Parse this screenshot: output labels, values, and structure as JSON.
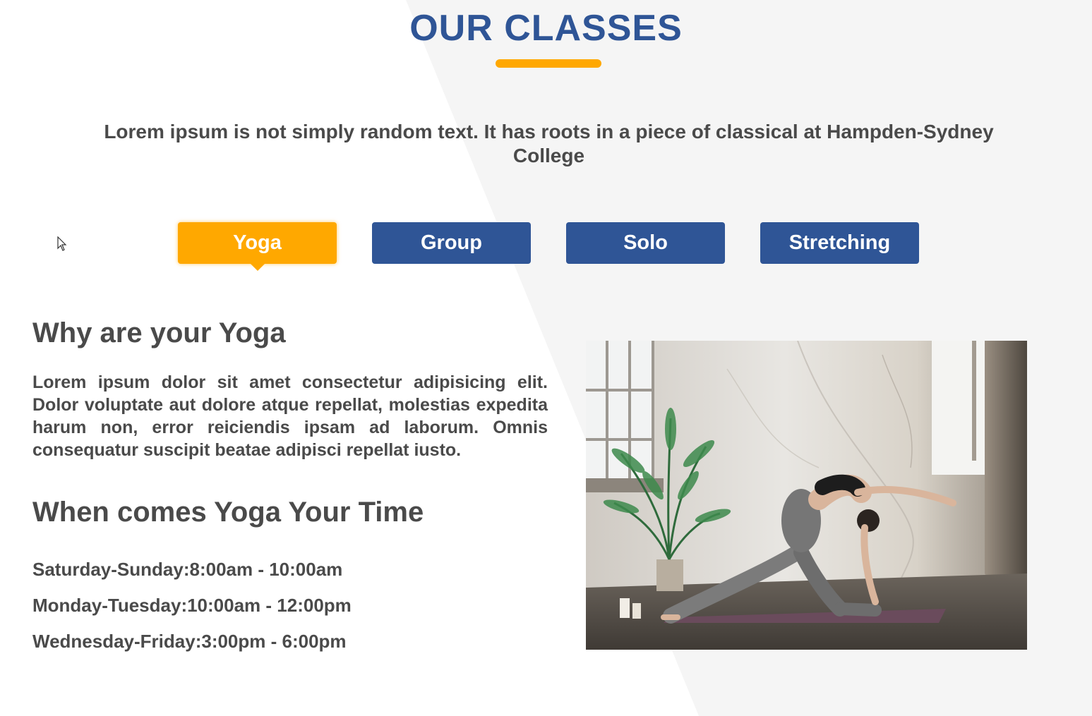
{
  "section": {
    "title": "OUR CLASSES",
    "subtitle": "Lorem ipsum is not simply random text. It has roots in a piece of classical at Hampden-Sydney College"
  },
  "tabs": [
    {
      "label": "Yoga",
      "active": true
    },
    {
      "label": "Group",
      "active": false
    },
    {
      "label": "Solo",
      "active": false
    },
    {
      "label": "Stretching",
      "active": false
    }
  ],
  "content": {
    "heading_why": "Why are your Yoga",
    "paragraph": "Lorem ipsum dolor sit amet consectetur adipisicing elit. Dolor voluptate aut dolore atque repellat, molestias expedita harum non, error reiciendis ipsam ad laborum. Omnis consequatur suscipit beatae adipisci repellat iusto.",
    "heading_time": "When comes Yoga Your Time",
    "schedule": [
      "Saturday-Sunday:8:00am - 10:00am",
      "Monday-Tuesday:10:00am - 12:00pm",
      "Wednesday-Friday:3:00pm - 6:00pm"
    ]
  },
  "colors": {
    "primary": "#2f5596",
    "accent": "#ffa800",
    "text": "#4a4a4a",
    "background_shape": "#f5f5f5"
  },
  "icons": {
    "cursor": "mouse-pointer-icon"
  }
}
